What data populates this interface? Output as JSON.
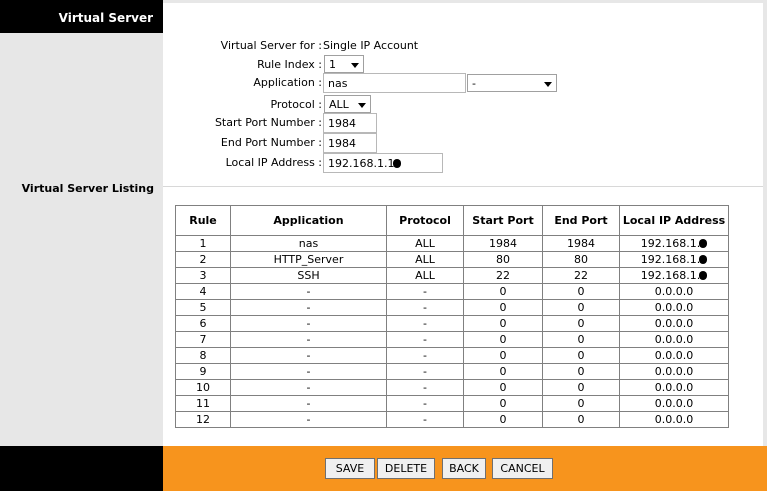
{
  "sidebar": {
    "title": "Virtual Server",
    "listing_label": "Virtual Server Listing"
  },
  "form": {
    "vs_for_label": "Virtual Server for :",
    "vs_for_value": "Single IP Account",
    "rule_index_label": "Rule Index :",
    "rule_index_value": "1",
    "application_label": "Application :",
    "application_value": "nas",
    "application_select_value": "-",
    "protocol_label": "Protocol :",
    "protocol_value": "ALL",
    "start_port_label": "Start Port Number :",
    "start_port_value": "1984",
    "end_port_label": "End Port Number :",
    "end_port_value": "1984",
    "local_ip_label": "Local IP Address :",
    "local_ip_value": "192.168.1.1"
  },
  "table": {
    "headers": [
      "Rule",
      "Application",
      "Protocol",
      "Start Port",
      "End Port",
      "Local IP Address"
    ],
    "rows": [
      [
        "1",
        "nas",
        "ALL",
        "1984",
        "1984",
        "192.168.1."
      ],
      [
        "2",
        "HTTP_Server",
        "ALL",
        "80",
        "80",
        "192.168.1."
      ],
      [
        "3",
        "SSH",
        "ALL",
        "22",
        "22",
        "192.168.1."
      ],
      [
        "4",
        "-",
        "-",
        "0",
        "0",
        "0.0.0.0"
      ],
      [
        "5",
        "-",
        "-",
        "0",
        "0",
        "0.0.0.0"
      ],
      [
        "6",
        "-",
        "-",
        "0",
        "0",
        "0.0.0.0"
      ],
      [
        "7",
        "-",
        "-",
        "0",
        "0",
        "0.0.0.0"
      ],
      [
        "8",
        "-",
        "-",
        "0",
        "0",
        "0.0.0.0"
      ],
      [
        "9",
        "-",
        "-",
        "0",
        "0",
        "0.0.0.0"
      ],
      [
        "10",
        "-",
        "-",
        "0",
        "0",
        "0.0.0.0"
      ],
      [
        "11",
        "-",
        "-",
        "0",
        "0",
        "0.0.0.0"
      ],
      [
        "12",
        "-",
        "-",
        "0",
        "0",
        "0.0.0.0"
      ]
    ]
  },
  "buttons": {
    "save": "SAVE",
    "delete": "DELETE",
    "back": "BACK",
    "cancel": "CANCEL"
  },
  "colors": {
    "footer_accent": "#f7941d",
    "sidebar_bg": "#e7e7e7",
    "header_bg": "#000000"
  }
}
